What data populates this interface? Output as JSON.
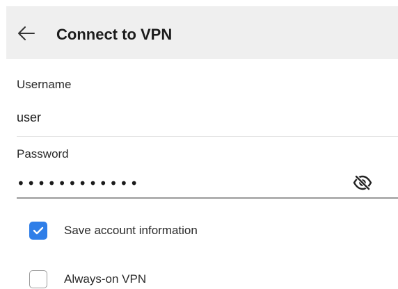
{
  "header": {
    "title": "Connect to VPN",
    "back_icon": "arrow-left-icon"
  },
  "form": {
    "username": {
      "label": "Username",
      "value": "user"
    },
    "password": {
      "label": "Password",
      "masked_value": "••••••••••••",
      "toggle_icon": "eye-off-icon"
    },
    "options": [
      {
        "label": "Save account information",
        "checked": true
      },
      {
        "label": "Always-on VPN",
        "checked": false
      }
    ]
  },
  "colors": {
    "accent": "#2f7ee8",
    "header_bg": "#efefef"
  }
}
